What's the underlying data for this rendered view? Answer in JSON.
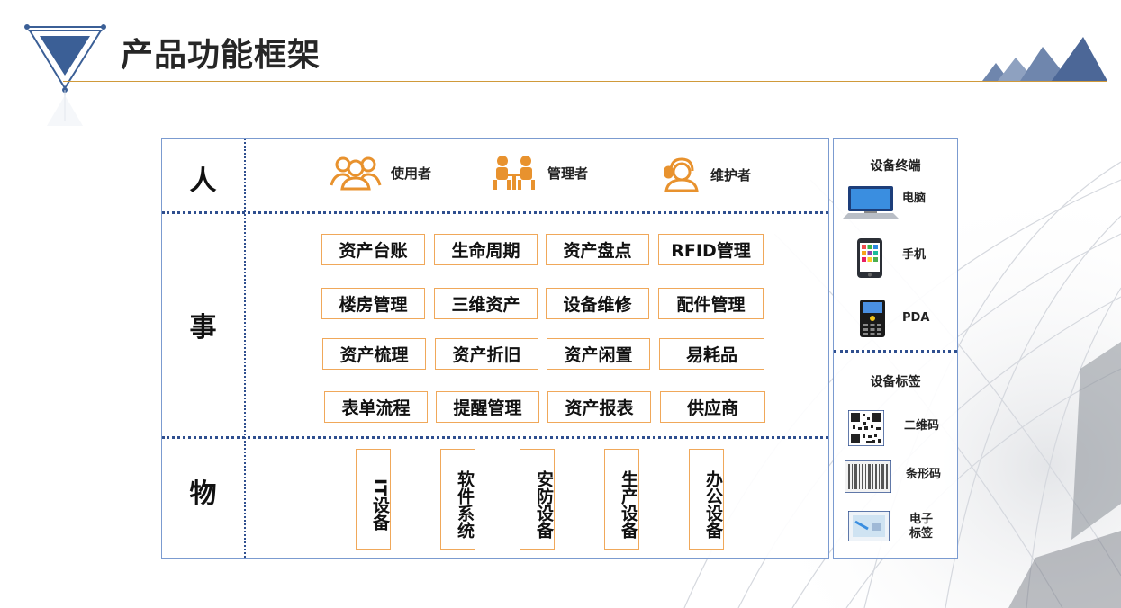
{
  "title": "产品功能框架",
  "colors": {
    "accent_orange": "#f0a85a",
    "frame_blue": "#7b9bd0",
    "divider_navy": "#2f4f8f",
    "title_line": "#d09a3a",
    "triangle_blue": "#3b5f96"
  },
  "rows": {
    "people": "人",
    "things": "事",
    "objects": "物"
  },
  "roles": [
    {
      "label": "使用者",
      "icon": "users-group-icon"
    },
    {
      "label": "管理者",
      "icon": "managers-meeting-icon"
    },
    {
      "label": "维护者",
      "icon": "support-agent-icon"
    }
  ],
  "functions": [
    [
      "资产台账",
      "生命周期",
      "资产盘点",
      "RFID管理"
    ],
    [
      "楼房管理",
      "三维资产",
      "设备维修",
      "配件管理"
    ],
    [
      "资产梳理",
      "资产折旧",
      "资产闲置",
      "易耗品"
    ],
    [
      "表单流程",
      "提醒管理",
      "资产报表",
      "供应商"
    ]
  ],
  "objects": [
    "IT设备",
    "软件系统",
    "安防设备",
    "生产设备",
    "办公设备"
  ],
  "terminals": {
    "heading": "设备终端",
    "items": [
      {
        "label": "电脑",
        "icon": "computer-icon"
      },
      {
        "label": "手机",
        "icon": "smartphone-icon"
      },
      {
        "label": "PDA",
        "icon": "pda-icon"
      }
    ]
  },
  "tags": {
    "heading": "设备标签",
    "items": [
      {
        "label": "二维码",
        "icon": "qr-code-icon"
      },
      {
        "label": "条形码",
        "icon": "barcode-icon"
      },
      {
        "label": "电子\n标签",
        "icon": "rfid-tag-icon"
      }
    ]
  }
}
